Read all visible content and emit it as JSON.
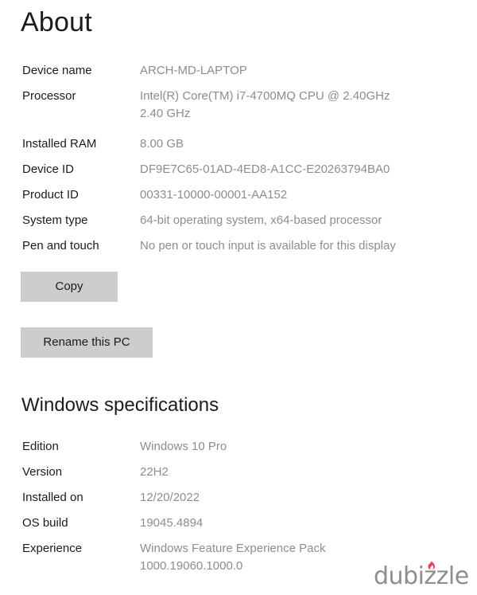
{
  "page": {
    "title": "About"
  },
  "device_specs": {
    "rows": [
      {
        "label": "Device name",
        "value": "ARCH-MD-LAPTOP"
      },
      {
        "label": "Processor",
        "value": "Intel(R) Core(TM) i7-4700MQ CPU @ 2.40GHz",
        "value_line2": "2.40 GHz"
      },
      {
        "label": "Installed RAM",
        "value": "8.00 GB"
      },
      {
        "label": "Device ID",
        "value": "DF9E7C65-01AD-4ED8-A1CC-E20263794BA0"
      },
      {
        "label": "Product ID",
        "value": "00331-10000-00001-AA152"
      },
      {
        "label": "System type",
        "value": "64-bit operating system, x64-based processor"
      },
      {
        "label": "Pen and touch",
        "value": "No pen or touch input is available for this display"
      }
    ]
  },
  "buttons": {
    "copy": "Copy",
    "rename": "Rename this PC"
  },
  "windows_specifications": {
    "heading": "Windows specifications",
    "rows": [
      {
        "label": "Edition",
        "value": "Windows 10 Pro"
      },
      {
        "label": "Version",
        "value": "22H2"
      },
      {
        "label": "Installed on",
        "value": "12/20/2022"
      },
      {
        "label": "OS build",
        "value": "19045.4894"
      },
      {
        "label": "Experience",
        "value": "Windows Feature Experience Pack",
        "value_line2": "1000.19060.1000.0"
      }
    ]
  },
  "watermark": {
    "text": "dubizzle",
    "icon": "flame-icon",
    "text_color": "#8e8e8e",
    "flame_color": "#e8455a"
  },
  "colors": {
    "background": "#ffffff",
    "label_text": "#1b1b1b",
    "value_text": "#8d8d8d",
    "button_background": "#cdcdcd"
  }
}
